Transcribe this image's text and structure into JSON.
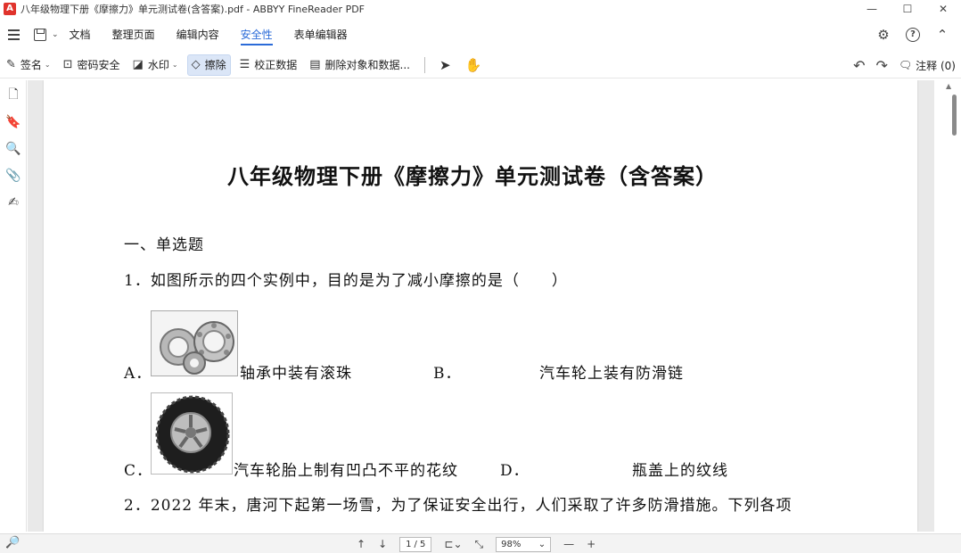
{
  "window": {
    "title": "八年级物理下册《摩擦力》单元测试卷(含答案).pdf - ABBYY FineReader PDF",
    "logo_letter": "A",
    "controls": {
      "minimize": "—",
      "maximize": "☐",
      "close": "✕"
    }
  },
  "menubar": {
    "items": [
      {
        "label": "文档",
        "active": false
      },
      {
        "label": "整理页面",
        "active": false
      },
      {
        "label": "编辑内容",
        "active": false
      },
      {
        "label": "安全性",
        "active": true
      },
      {
        "label": "表单编辑器",
        "active": false
      }
    ]
  },
  "toolbar": {
    "tools": [
      {
        "label": "签名",
        "icon": "✎",
        "icon_name": "pen-icon",
        "dropdown": true,
        "active": false
      },
      {
        "label": "密码安全",
        "icon": "🔒",
        "icon_name": "lock-icon",
        "dropdown": false,
        "active": false
      },
      {
        "label": "水印",
        "icon": "💧",
        "icon_name": "watermark-icon",
        "dropdown": true,
        "active": false
      },
      {
        "label": "擦除",
        "icon": "⌫",
        "icon_name": "eraser-icon",
        "dropdown": false,
        "active": true
      },
      {
        "label": "校正数据",
        "icon": "☰",
        "icon_name": "redact-icon",
        "dropdown": false,
        "active": false
      },
      {
        "label": "删除对象和数据...",
        "icon": "🗎",
        "icon_name": "delete-objects-icon",
        "dropdown": false,
        "active": false
      }
    ],
    "comment_label": "注释 (0)"
  },
  "document": {
    "title": "八年级物理下册《摩擦力》单元测试卷（含答案）",
    "section": "一、单选题",
    "q1": "1．如图所示的四个实例中，目的是为了减小摩擦的是（　　）",
    "optA_label": "A．",
    "optA_text": "轴承中装有滚珠",
    "optB_label": "B．",
    "optB_text": "汽车轮上装有防滑链",
    "optC_label": "C．",
    "optC_text": "汽车轮胎上制有凹凸不平的花纹",
    "optD_label": "D．",
    "optD_text": "瓶盖上的纹线",
    "q2": "2．2022 年末，唐河下起第一场雪，为了保证安全出行，人们采取了许多防滑措施。下列各项"
  },
  "statusbar": {
    "current_page": "1",
    "total_pages": "/ 5",
    "zoom": "98%"
  }
}
